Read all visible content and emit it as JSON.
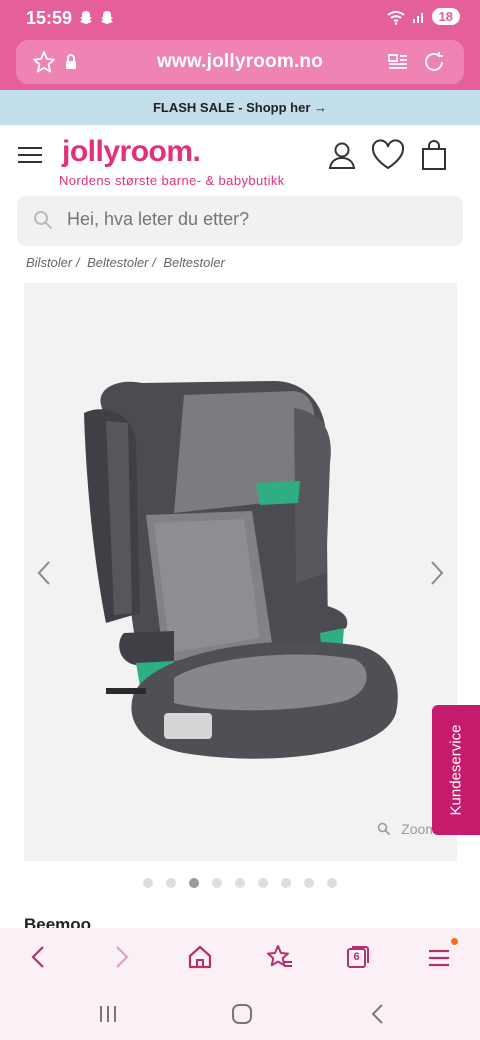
{
  "status": {
    "time": "15:59",
    "battery": "18"
  },
  "browser": {
    "url": "www.jollyroom.no"
  },
  "flash_sale": {
    "text": "FLASH SALE - Shopp her →"
  },
  "header": {
    "logo": "jollyroom.",
    "tagline": "Nordens største barne- & babybutikk"
  },
  "search": {
    "placeholder": "Hei, hva leter du etter?"
  },
  "breadcrumb": [
    "Bilstoler /",
    "Beltestoler /",
    "Beltestoler"
  ],
  "gallery": {
    "zoom_label": "Zoom",
    "slide_count": 9,
    "active_slide": 3
  },
  "kundeservice": {
    "label": "Kundeservice"
  },
  "product": {
    "brand": "Beemoo"
  },
  "toolbar": {
    "tabs_count": "6"
  },
  "colors": {
    "brand_pink": "#e0307e",
    "browser_pink": "#e5609a",
    "flash_bg": "#c2dfeb",
    "kundeservice": "#c41b6d"
  }
}
